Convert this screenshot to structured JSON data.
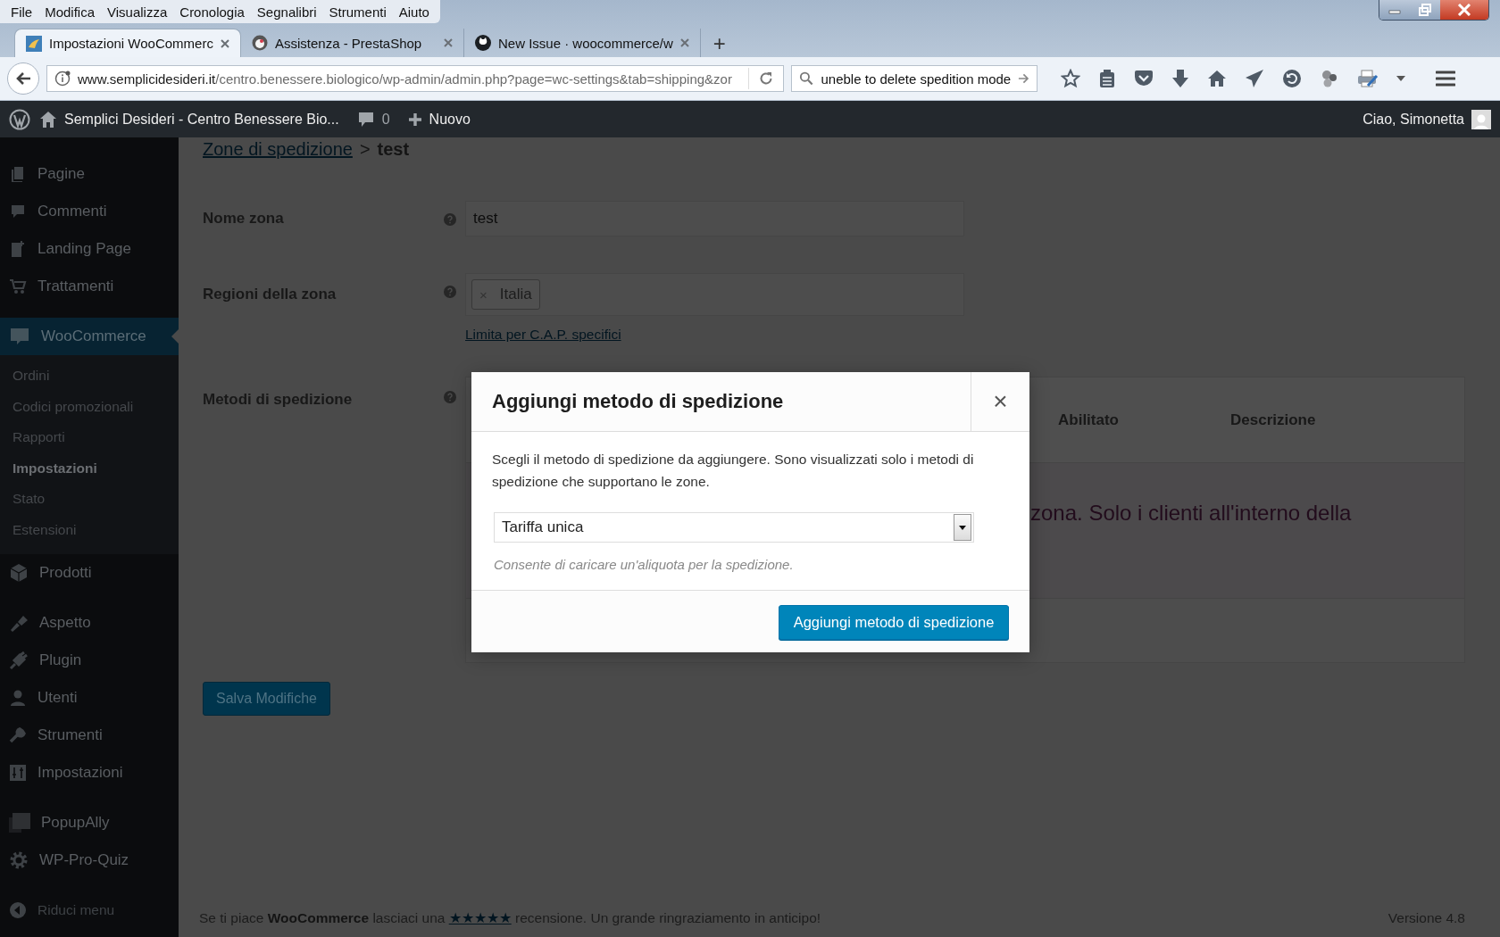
{
  "browser": {
    "menu": [
      "File",
      "Modifica",
      "Visualizza",
      "Cronologia",
      "Segnalibri",
      "Strumenti",
      "Aiuto"
    ],
    "tabs": [
      {
        "label": "Impostazioni WooCommerc",
        "selected": true
      },
      {
        "label": "Assistenza - PrestaShop",
        "selected": false
      },
      {
        "label": "New Issue · woocommerce/w",
        "selected": false
      }
    ],
    "new_tab": "+",
    "url": {
      "domain": "www.semplicidesideri.it",
      "path": "/centro.benessere.biologico/wp-admin/admin.php?page=wc-settings&tab=shipping&zor"
    },
    "search": {
      "value": "uneble to delete spedition mode"
    }
  },
  "admin_bar": {
    "site": "Semplici Desideri - Centro Benessere Bio...",
    "comments": "0",
    "new": "Nuovo",
    "greeting": "Ciao, Simonetta"
  },
  "sidebar": {
    "groups": [
      [
        {
          "label": "Pagine",
          "selected": false
        },
        {
          "label": "Commenti",
          "selected": false
        },
        {
          "label": "Landing Page",
          "selected": false
        },
        {
          "label": "Trattamenti",
          "selected": false
        }
      ],
      [
        {
          "label": "WooCommerce",
          "selected": true,
          "children": [
            {
              "label": "Ordini",
              "selected": false
            },
            {
              "label": "Codici promozionali",
              "selected": false
            },
            {
              "label": "Rapporti",
              "selected": false
            },
            {
              "label": "Impostazioni",
              "selected": true
            },
            {
              "label": "Stato",
              "selected": false
            },
            {
              "label": "Estensioni",
              "selected": false
            }
          ]
        },
        {
          "label": "Prodotti",
          "selected": false
        }
      ],
      [
        {
          "label": "Aspetto",
          "selected": false
        },
        {
          "label": "Plugin",
          "selected": false
        },
        {
          "label": "Utenti",
          "selected": false
        },
        {
          "label": "Strumenti",
          "selected": false
        },
        {
          "label": "Impostazioni",
          "selected": false
        }
      ],
      [
        {
          "label": "PopupAlly",
          "selected": false
        },
        {
          "label": "WP-Pro-Quiz",
          "selected": false
        }
      ]
    ],
    "collapse": "Riduci menu"
  },
  "breadcrumb": {
    "link": "Zone di spedizione",
    "separator": ">",
    "current": "test"
  },
  "form": {
    "rows": [
      {
        "kind": "text",
        "label": "Nome zona",
        "value": "test"
      },
      {
        "kind": "tags",
        "label": "Regioni della zona",
        "tags": [
          {
            "label": "Italia",
            "remove": "×"
          }
        ],
        "link": "Limita per C.A.P. specifici"
      },
      {
        "kind": "methods",
        "label": "Metodi di spedizione",
        "columns": [
          "Abilitato",
          "Descrizione"
        ],
        "message": "zona. Solo i clienti all'interno della"
      }
    ]
  },
  "save_button": "Salva Modifiche",
  "modal": {
    "title": "Aggiungi metodo di spedizione",
    "close": "×",
    "description": "Scegli il metodo di spedizione da aggiungere. Sono visualizzati solo i metodi di spedizione che supportano le zone.",
    "select": {
      "value": "Tariffa unica"
    },
    "hint": "Consente di caricare un'aliquota per la spedizione.",
    "button": "Aggiungi metodo di spedizione"
  },
  "footer": {
    "text": "Se ti piace **WooCommerce** lasciaci una",
    "rating_link": "★★★★★",
    "text_after": "recensione. Un grande ringraziamento in anticipo!",
    "version": "Versione 4.8"
  }
}
